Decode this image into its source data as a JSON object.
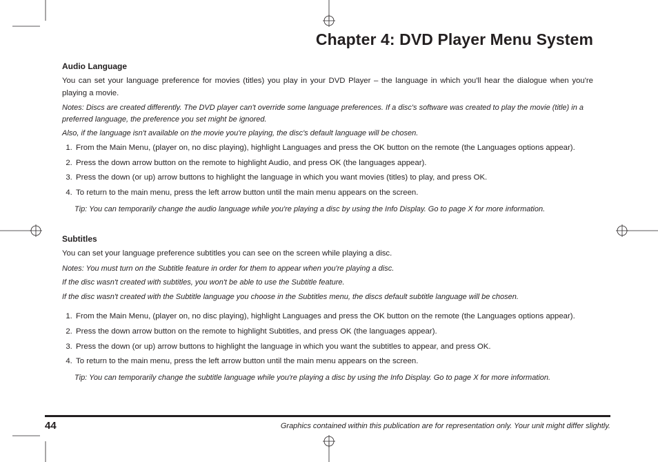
{
  "chapter_title": "Chapter 4: DVD Player Menu System",
  "audio": {
    "heading": "Audio Language",
    "intro": "You can set your language preference for movies (titles) you play in your DVD Player – the language in which you'll hear the dialogue when you're playing a movie.",
    "note1": "Notes: Discs are created differently. The DVD player can't override some language preferences. If a disc's software was created to play the movie (title) in a preferred language, the preference you set might be ignored.",
    "note2": "Also, if the language isn't available on the movie you're playing, the disc's default language will be chosen.",
    "steps": [
      "From the Main Menu, (player on, no disc playing), highlight Languages and press the OK button on the remote (the Languages options appear).",
      "Press the down arrow button on the remote to highlight Audio, and press OK (the languages appear).",
      "Press the down (or up) arrow buttons to highlight the language in which you want movies (titles) to play, and press OK.",
      "To return to the main menu, press the left arrow button until the main menu appears on the screen."
    ],
    "tip": "Tip: You can temporarily change the audio language while you're playing a disc by using the Info Display. Go to page X for more information."
  },
  "subtitles": {
    "heading": "Subtitles",
    "intro": "You can set your language preference subtitles you can see on the screen while playing a disc.",
    "note1": "Notes: You must turn on the Subtitle feature in order for them to appear when you're playing a disc.",
    "note2": "If the disc wasn't created with subtitles, you won't be able to use the Subtitle feature.",
    "note3": "If the disc wasn't created with the Subtitle language you choose in the Subtitles menu, the discs default subtitle language will be chosen.",
    "steps": [
      "From the Main Menu, (player on, no disc playing), highlight Languages and press the OK button on the remote (the Languages options appear).",
      "Press the down arrow button on the remote to highlight Subtitles, and press OK (the languages appear).",
      "Press the down (or up) arrow buttons to highlight the language in which you want the subtitles to appear, and press OK.",
      "To return to the main menu, press the left arrow button until the main menu appears on the screen."
    ],
    "tip": "Tip: You can temporarily change the subtitle language while you're playing a disc by using the Info Display. Go to page X for more information."
  },
  "footer": {
    "page": "44",
    "caption": "Graphics contained within this publication are for representation only. Your unit might differ slightly."
  }
}
